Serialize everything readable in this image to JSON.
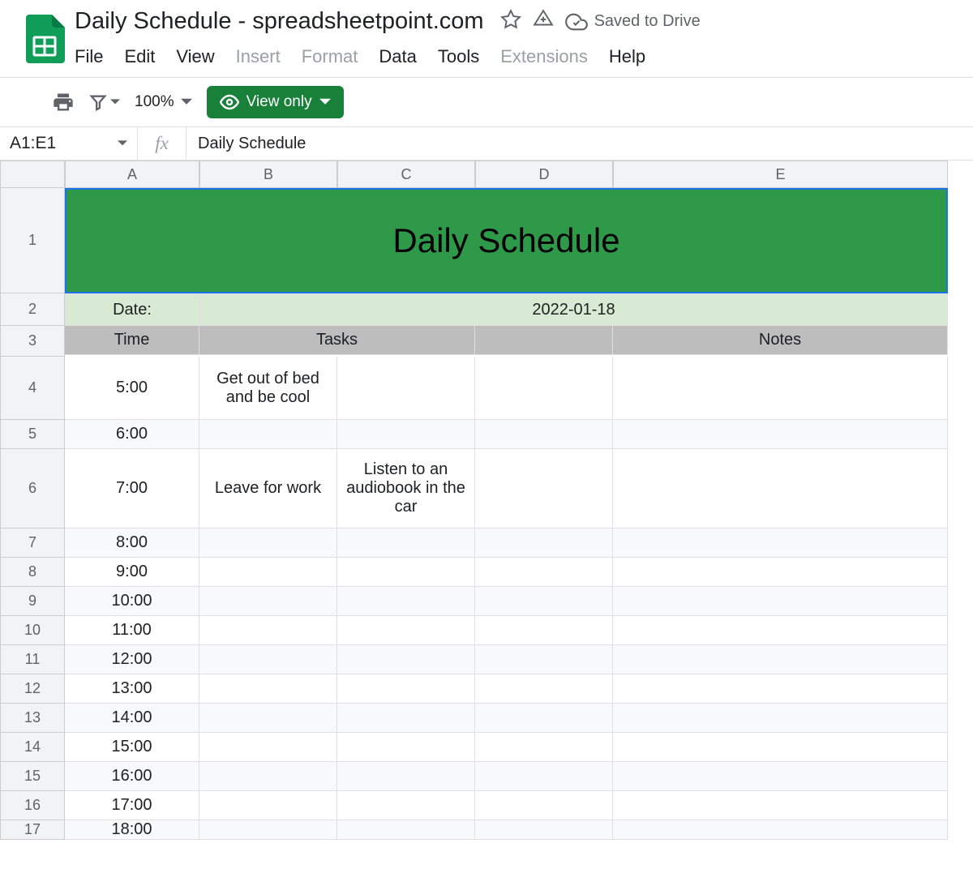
{
  "header": {
    "title": "Daily Schedule - spreadsheetpoint.com",
    "saved": "Saved to Drive"
  },
  "menu": {
    "file": "File",
    "edit": "Edit",
    "view": "View",
    "insert": "Insert",
    "format": "Format",
    "data": "Data",
    "tools": "Tools",
    "extensions": "Extensions",
    "help": "Help"
  },
  "toolbar": {
    "zoom": "100%",
    "view_only": "View only"
  },
  "formula_bar": {
    "cell_ref": "A1:E1",
    "formula": "Daily Schedule"
  },
  "columns": [
    "A",
    "B",
    "C",
    "D",
    "E"
  ],
  "sheet": {
    "title": "Daily Schedule",
    "date_label": "Date:",
    "date_value": "2022-01-18",
    "headers": {
      "time": "Time",
      "tasks": "Tasks",
      "notes": "Notes"
    },
    "rows": [
      {
        "n": "4",
        "time": "5:00",
        "b": "Get out of bed and be cool",
        "c": "",
        "d": "",
        "e": "",
        "tall": true
      },
      {
        "n": "5",
        "time": "6:00",
        "b": "",
        "c": "",
        "d": "",
        "e": "",
        "alt": true
      },
      {
        "n": "6",
        "time": "7:00",
        "b": "Leave for work",
        "c": "Listen to  an audiobook in the car",
        "d": "",
        "e": "",
        "xtall": true
      },
      {
        "n": "7",
        "time": "8:00",
        "b": "",
        "c": "",
        "d": "",
        "e": "",
        "alt": true
      },
      {
        "n": "8",
        "time": "9:00",
        "b": "",
        "c": "",
        "d": "",
        "e": ""
      },
      {
        "n": "9",
        "time": "10:00",
        "b": "",
        "c": "",
        "d": "",
        "e": "",
        "alt": true
      },
      {
        "n": "10",
        "time": "11:00",
        "b": "",
        "c": "",
        "d": "",
        "e": ""
      },
      {
        "n": "11",
        "time": "12:00",
        "b": "",
        "c": "",
        "d": "",
        "e": "",
        "alt": true
      },
      {
        "n": "12",
        "time": "13:00",
        "b": "",
        "c": "",
        "d": "",
        "e": ""
      },
      {
        "n": "13",
        "time": "14:00",
        "b": "",
        "c": "",
        "d": "",
        "e": "",
        "alt": true
      },
      {
        "n": "14",
        "time": "15:00",
        "b": "",
        "c": "",
        "d": "",
        "e": ""
      },
      {
        "n": "15",
        "time": "16:00",
        "b": "",
        "c": "",
        "d": "",
        "e": "",
        "alt": true
      },
      {
        "n": "16",
        "time": "17:00",
        "b": "",
        "c": "",
        "d": "",
        "e": ""
      },
      {
        "n": "17",
        "time": "18:00",
        "b": "",
        "c": "",
        "d": "",
        "e": "",
        "alt": true,
        "clip": true
      }
    ]
  }
}
